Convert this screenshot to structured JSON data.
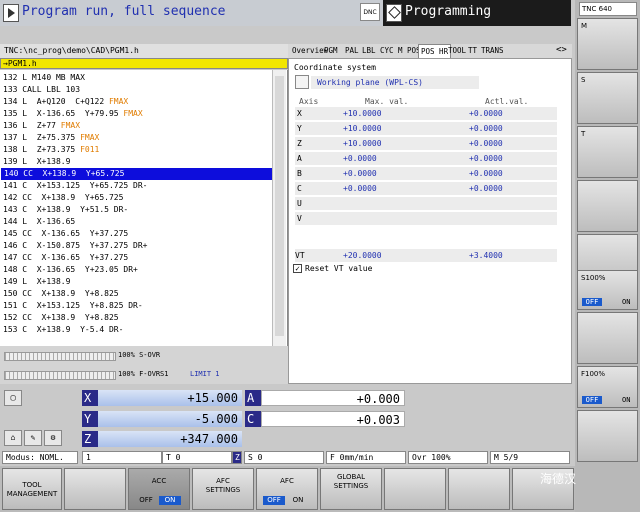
{
  "header": {
    "left_title": "Program run, full sequence",
    "dnc_label": "DNC",
    "right_title": "Programming"
  },
  "program": {
    "path": "TNC:\\nc_prog\\demo\\CAD\\PGM1.h",
    "tab": "→PGM1.h",
    "lines": [
      {
        "text": "132 L M140 MB MAX",
        "fmax": ""
      },
      {
        "text": "133 CALL LBL 103",
        "fmax": ""
      },
      {
        "text": "134 L  A+Q120  C+Q122 ",
        "fmax": "FMAX"
      },
      {
        "text": "135 L  X-136.65  Y+79.95 ",
        "fmax": "FMAX"
      },
      {
        "text": "136 L  Z+77 ",
        "fmax": "FMAX"
      },
      {
        "text": "137 L  Z+75.375 ",
        "fmax": "FMAX"
      },
      {
        "text": "138 L  Z+73.375 ",
        "fmax": "F011"
      },
      {
        "text": "139 L  X+138.9",
        "fmax": ""
      },
      {
        "text": "140 CC  X+138.9  Y+65.725",
        "fmax": "",
        "selected": true
      },
      {
        "text": "141 C  X+153.125  Y+65.725 DR-",
        "fmax": ""
      },
      {
        "text": "142 CC  X+138.9  Y+65.725",
        "fmax": ""
      },
      {
        "text": "143 C  X+138.9  Y+51.5 DR-",
        "fmax": ""
      },
      {
        "text": "144 L  X-136.65",
        "fmax": ""
      },
      {
        "text": "145 CC  X-136.65  Y+37.275",
        "fmax": ""
      },
      {
        "text": "146 C  X-150.875  Y+37.275 DR+",
        "fmax": ""
      },
      {
        "text": "147 CC  X-136.65  Y+37.275",
        "fmax": ""
      },
      {
        "text": "148 C  X-136.65  Y+23.05 DR+",
        "fmax": ""
      },
      {
        "text": "149 L  X+138.9",
        "fmax": ""
      },
      {
        "text": "150 CC  X+138.9  Y+8.825",
        "fmax": ""
      },
      {
        "text": "151 C  X+153.125  Y+8.825 DR-",
        "fmax": ""
      },
      {
        "text": "152 CC  X+138.9  Y+8.825",
        "fmax": ""
      },
      {
        "text": "153 C  X+138.9  Y-5.4 DR-",
        "fmax": ""
      }
    ],
    "s_ovr": "100% S-OVR",
    "f_ovr": "100% F-OVR",
    "s1": "S1",
    "limit": "LIMIT 1"
  },
  "status": {
    "tabs": [
      "Overview",
      "PGM",
      "PAL",
      "LBL",
      "CYC",
      "M",
      "POS",
      "POS HR",
      "TOOL",
      "TT",
      "TRANS"
    ],
    "coord_sys": "Coordinate system",
    "working_plane": "Working plane (WPL-CS)",
    "col_axis": "Axis",
    "col_max": "Max. val.",
    "col_actl": "Actl.val.",
    "axes": [
      {
        "axis": "X",
        "max": "+10.0000",
        "actl": "+0.0000"
      },
      {
        "axis": "Y",
        "max": "+10.0000",
        "actl": "+0.0000"
      },
      {
        "axis": "Z",
        "max": "+10.0000",
        "actl": "+0.0000"
      },
      {
        "axis": "A",
        "max": "+0.0000",
        "actl": "+0.0000"
      },
      {
        "axis": "B",
        "max": "+0.0000",
        "actl": "+0.0000"
      },
      {
        "axis": "C",
        "max": "+0.0000",
        "actl": "+0.0000"
      },
      {
        "axis": "U",
        "max": "",
        "actl": ""
      },
      {
        "axis": "V",
        "max": "",
        "actl": ""
      }
    ],
    "vt": {
      "axis": "VT",
      "max": "+20.0000",
      "actl": "+3.4000"
    },
    "reset_vt": "Reset VT value"
  },
  "coords": {
    "x": {
      "label": "X",
      "value": "+15.000"
    },
    "y": {
      "label": "Y",
      "value": "-5.000"
    },
    "z": {
      "label": "Z",
      "value": "+347.000"
    },
    "a": {
      "label": "A",
      "value": "+0.000"
    },
    "c": {
      "label": "C",
      "value": "+0.003"
    }
  },
  "statusbar": {
    "mode": "Modus: NOML.",
    "tool_num": "1",
    "t": "T 0",
    "z": "Z",
    "s": "S 0",
    "f": "F 0mm/min",
    "ovr": "Ovr 100%",
    "m": "M 5/9"
  },
  "softkeys": {
    "tool_mgmt": "TOOL\nMANAGEMENT",
    "acc": "ACC",
    "afc_settings": "AFC\nSETTINGS",
    "afc": "AFC",
    "global": "GLOBAL\nSETTINGS",
    "off": "OFF",
    "on": "ON"
  },
  "vkeys": {
    "tnc": "TNC 640",
    "m": "M",
    "s": "S",
    "t": "T",
    "s100": "S100%",
    "f100": "F100%",
    "off": "OFF",
    "on": "ON"
  },
  "watermark": "海德汉"
}
